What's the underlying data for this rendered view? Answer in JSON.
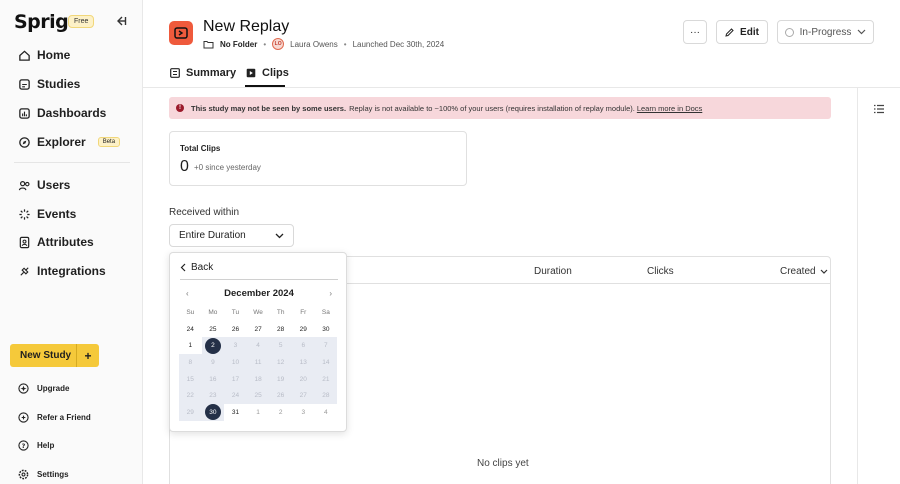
{
  "sidebar": {
    "logo": "Sprig",
    "plan_badge": "Free",
    "nav": [
      {
        "label": "Home",
        "icon": "home-icon"
      },
      {
        "label": "Studies",
        "icon": "studies-icon"
      },
      {
        "label": "Dashboards",
        "icon": "dashboards-icon"
      },
      {
        "label": "Explorer",
        "icon": "explorer-icon",
        "badge": "Beta"
      },
      {
        "label": "Users",
        "icon": "users-icon"
      },
      {
        "label": "Events",
        "icon": "events-icon"
      },
      {
        "label": "Attributes",
        "icon": "attributes-icon"
      },
      {
        "label": "Integrations",
        "icon": "integrations-icon"
      }
    ],
    "new_study_label": "New Study",
    "bottom": [
      {
        "label": "Upgrade",
        "icon": "upgrade-icon"
      },
      {
        "label": "Refer a Friend",
        "icon": "refer-icon"
      },
      {
        "label": "Help",
        "icon": "help-icon"
      },
      {
        "label": "Settings",
        "icon": "settings-icon"
      }
    ]
  },
  "header": {
    "title": "New Replay",
    "folder": "No Folder",
    "owner_initials": "LO",
    "owner": "Laura Owens",
    "launched": "Launched Dec 30th, 2024",
    "more_label": "···",
    "edit_label": "Edit",
    "status_label": "In-Progress"
  },
  "tabs": [
    {
      "label": "Summary",
      "active": false
    },
    {
      "label": "Clips",
      "active": true
    }
  ],
  "banner": {
    "bold": "This study may not be seen by some users.",
    "text": "Replay is not available to ~100% of your users (requires installation of replay module).",
    "link": "Learn more in Docs"
  },
  "total_clips": {
    "title": "Total Clips",
    "value": "0",
    "sub": "+0 since yesterday"
  },
  "filter": {
    "label": "Received within",
    "value": "Entire Duration"
  },
  "table": {
    "columns": [
      "Duration",
      "Clicks",
      "Created"
    ],
    "empty": "No clips yet"
  },
  "calendar": {
    "back_label": "Back",
    "month": "December 2024",
    "prev": "‹",
    "next": "›",
    "weekdays": [
      "Su",
      "Mo",
      "Tu",
      "We",
      "Th",
      "Fr",
      "Sa"
    ],
    "weeks": [
      [
        "24",
        "25",
        "26",
        "27",
        "28",
        "29",
        "30"
      ],
      [
        "1",
        "2",
        "3",
        "4",
        "5",
        "6",
        "7"
      ],
      [
        "8",
        "9",
        "10",
        "11",
        "12",
        "13",
        "14"
      ],
      [
        "15",
        "16",
        "17",
        "18",
        "19",
        "20",
        "21"
      ],
      [
        "22",
        "23",
        "24",
        "25",
        "26",
        "27",
        "28"
      ],
      [
        "29",
        "30",
        "31",
        "1",
        "2",
        "3",
        "4"
      ]
    ],
    "selected_start": "2",
    "selected_end": "30"
  }
}
